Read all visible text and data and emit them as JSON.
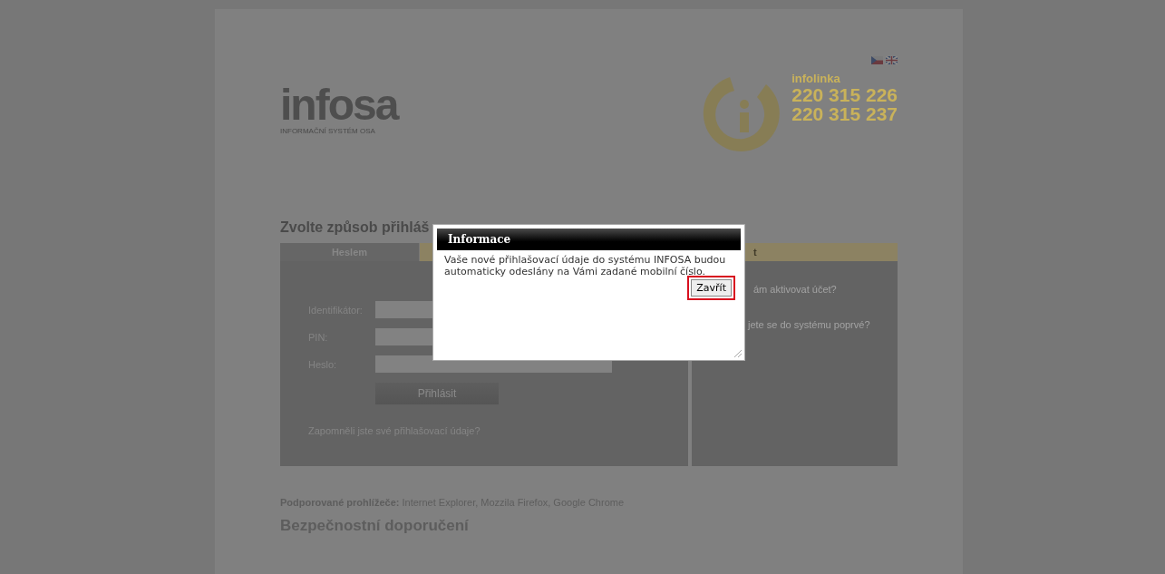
{
  "header": {
    "logo": "infosa",
    "logo_subtitle": "INFORMAČNÍ SYSTÉM OSA",
    "infoline": {
      "label": "infolinka",
      "phones": [
        "220 315 226",
        "220 315 237"
      ]
    }
  },
  "heading": "Zvolte způsob přihláš",
  "tabs": [
    {
      "label": "Heslem",
      "selected": true
    },
    {
      "selected": false
    }
  ],
  "form": {
    "fields": [
      {
        "label": "Identifikátor:"
      },
      {
        "label": "PIN:"
      },
      {
        "label": "Heslo:"
      }
    ],
    "submit": "Přihlásit",
    "forgot_link": "Zapomněli jste své přihlašovací údaje?"
  },
  "right_panel": {
    "tab_label": "t",
    "links": [
      "ám aktivovat účet?",
      "jete se do systému poprvé?"
    ]
  },
  "supported_browsers": "**Podporované prohlížeče:** Internet Explorer, Mozzila Firefox, Google Chrome",
  "security_heading": "Bezpečnostní doporučení",
  "dialog": {
    "title": "Informace",
    "message": "Vaše nové přihlašovací údaje do systému INFOSA budou automaticky odeslány na Vámi zadané mobilní číslo.",
    "button": "Zavřít"
  }
}
